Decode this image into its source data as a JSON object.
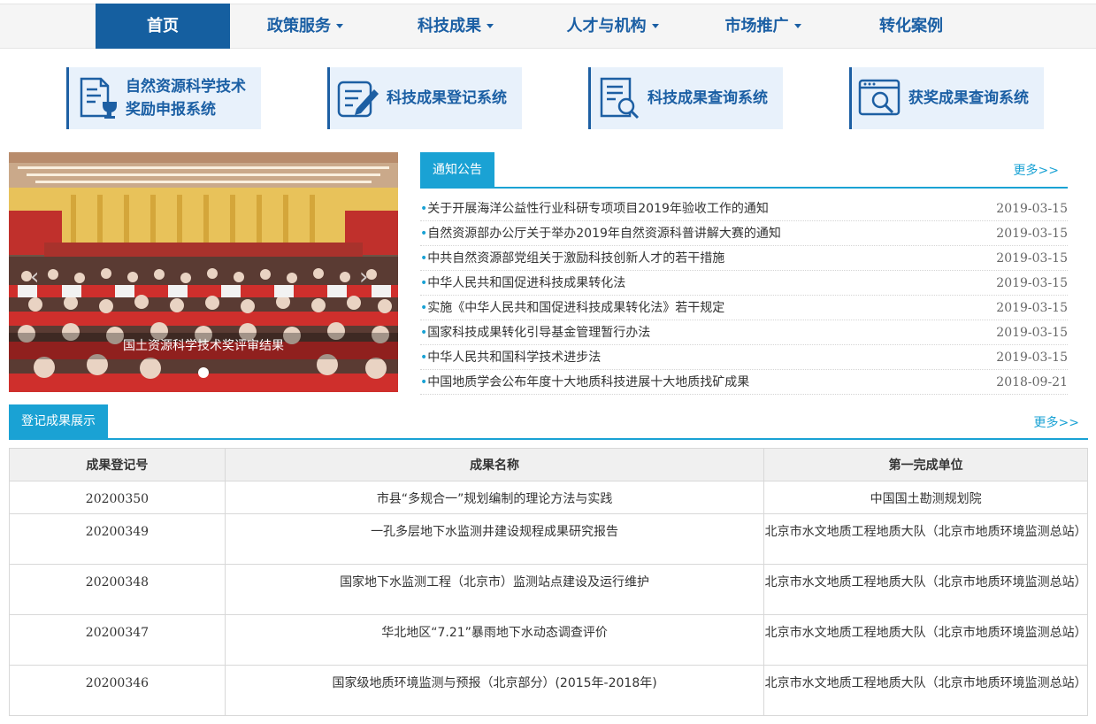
{
  "nav": {
    "items": [
      {
        "label": "首页",
        "active": true,
        "dropdown": false
      },
      {
        "label": "政策服务",
        "active": false,
        "dropdown": true
      },
      {
        "label": "科技成果",
        "active": false,
        "dropdown": true
      },
      {
        "label": "人才与机构",
        "active": false,
        "dropdown": true
      },
      {
        "label": "市场推广",
        "active": false,
        "dropdown": true
      },
      {
        "label": "转化案例",
        "active": false,
        "dropdown": false
      }
    ]
  },
  "systems": [
    {
      "label": "自然资源科学技术奖励申报系统",
      "icon": "award-document-icon"
    },
    {
      "label": "科技成果登记系统",
      "icon": "edit-document-icon"
    },
    {
      "label": "科技成果查询系统",
      "icon": "search-document-icon"
    },
    {
      "label": "获奖成果查询系统",
      "icon": "browser-search-icon"
    }
  ],
  "carousel": {
    "caption": "国土资源科学技术奖评审结果",
    "prev": "‹",
    "next": "›"
  },
  "notice": {
    "title": "通知公告",
    "more": "更多>>",
    "items": [
      {
        "title": "关于开展海洋公益性行业科研专项项目2019年验收工作的通知",
        "date": "2019-03-15"
      },
      {
        "title": "自然资源部办公厅关于举办2019年自然资源科普讲解大赛的通知",
        "date": "2019-03-15"
      },
      {
        "title": "中共自然资源部党组关于激励科技创新人才的若干措施",
        "date": "2019-03-15"
      },
      {
        "title": "中华人民共和国促进科技成果转化法",
        "date": "2019-03-15"
      },
      {
        "title": "实施《中华人民共和国促进科技成果转化法》若干规定",
        "date": "2019-03-15"
      },
      {
        "title": "国家科技成果转化引导基金管理暂行办法",
        "date": "2019-03-15"
      },
      {
        "title": "中华人民共和国科学技术进步法",
        "date": "2019-03-15"
      },
      {
        "title": "中国地质学会公布年度十大地质科技进展十大地质找矿成果",
        "date": "2018-09-21"
      }
    ]
  },
  "results": {
    "title": "登记成果展示",
    "more": "更多>>",
    "columns": [
      "成果登记号",
      "成果名称",
      "第一完成单位"
    ],
    "rows": [
      {
        "id": "20200350",
        "name": "市县“多规合一”规划编制的理论方法与实践",
        "unit": "中国国土勘测规划院"
      },
      {
        "id": "20200349",
        "name": "一孔多层地下水监测井建设规程成果研究报告",
        "unit": "北京市水文地质工程地质大队（北京市地质环境监测总站）"
      },
      {
        "id": "20200348",
        "name": "国家地下水监测工程（北京市）监测站点建设及运行维护",
        "unit": "北京市水文地质工程地质大队（北京市地质环境监测总站）"
      },
      {
        "id": "20200347",
        "name": "华北地区“7.21”暴雨地下水动态调查评价",
        "unit": "北京市水文地质工程地质大队（北京市地质环境监测总站）"
      },
      {
        "id": "20200346",
        "name": "国家级地质环境监测与预报（北京部分）(2015年-2018年)",
        "unit": "北京市水文地质工程地质大队（北京市地质环境监测总站）"
      }
    ]
  },
  "colors": {
    "nav_active_bg": "#155fa0",
    "nav_text": "#1b5fa4",
    "accent": "#1aa2d4",
    "system_bg": "#e8f1fb"
  }
}
